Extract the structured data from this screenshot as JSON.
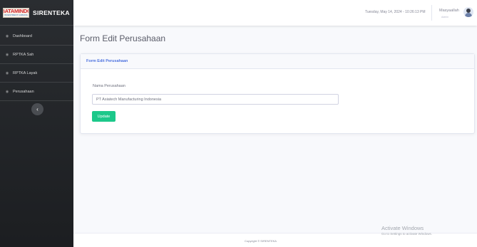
{
  "brand": {
    "logo_text": "BATAMINDO",
    "logo_subtext": "INVESTMENT CABANG",
    "app_name": "SIRENTEKA"
  },
  "sidebar": {
    "items": [
      {
        "label": "Dashboard",
        "icon": "dashboard-icon"
      },
      {
        "label": "RPTKA Sah",
        "icon": "document-icon"
      },
      {
        "label": "RPTKA Layak",
        "icon": "document-icon"
      },
      {
        "label": "Perusahaan",
        "icon": "building-icon"
      }
    ],
    "toggle_icon": "chevron-left-icon"
  },
  "topbar": {
    "datetime": "Tuesday, May 14, 2024 - 10:26:13 PM",
    "user_name": "Masyaallah",
    "user_role": "Admin"
  },
  "page": {
    "title": "Form Edit Perusahaan"
  },
  "card": {
    "header": "Form Edit Perusahaan",
    "field_label": "Nama Perusahaan",
    "field_value": "PT Asiatech Manufacturing Indonesia",
    "submit_label": "Update"
  },
  "footer": {
    "copyright": "Copyright © SIRENTEKA"
  },
  "watermark": {
    "line1": "Activate Windows",
    "line2": "Go to Settings to activate Windows."
  },
  "colors": {
    "sidebar_bg": "#2a2d31",
    "primary": "#4e73df",
    "success": "#1cc88a"
  }
}
